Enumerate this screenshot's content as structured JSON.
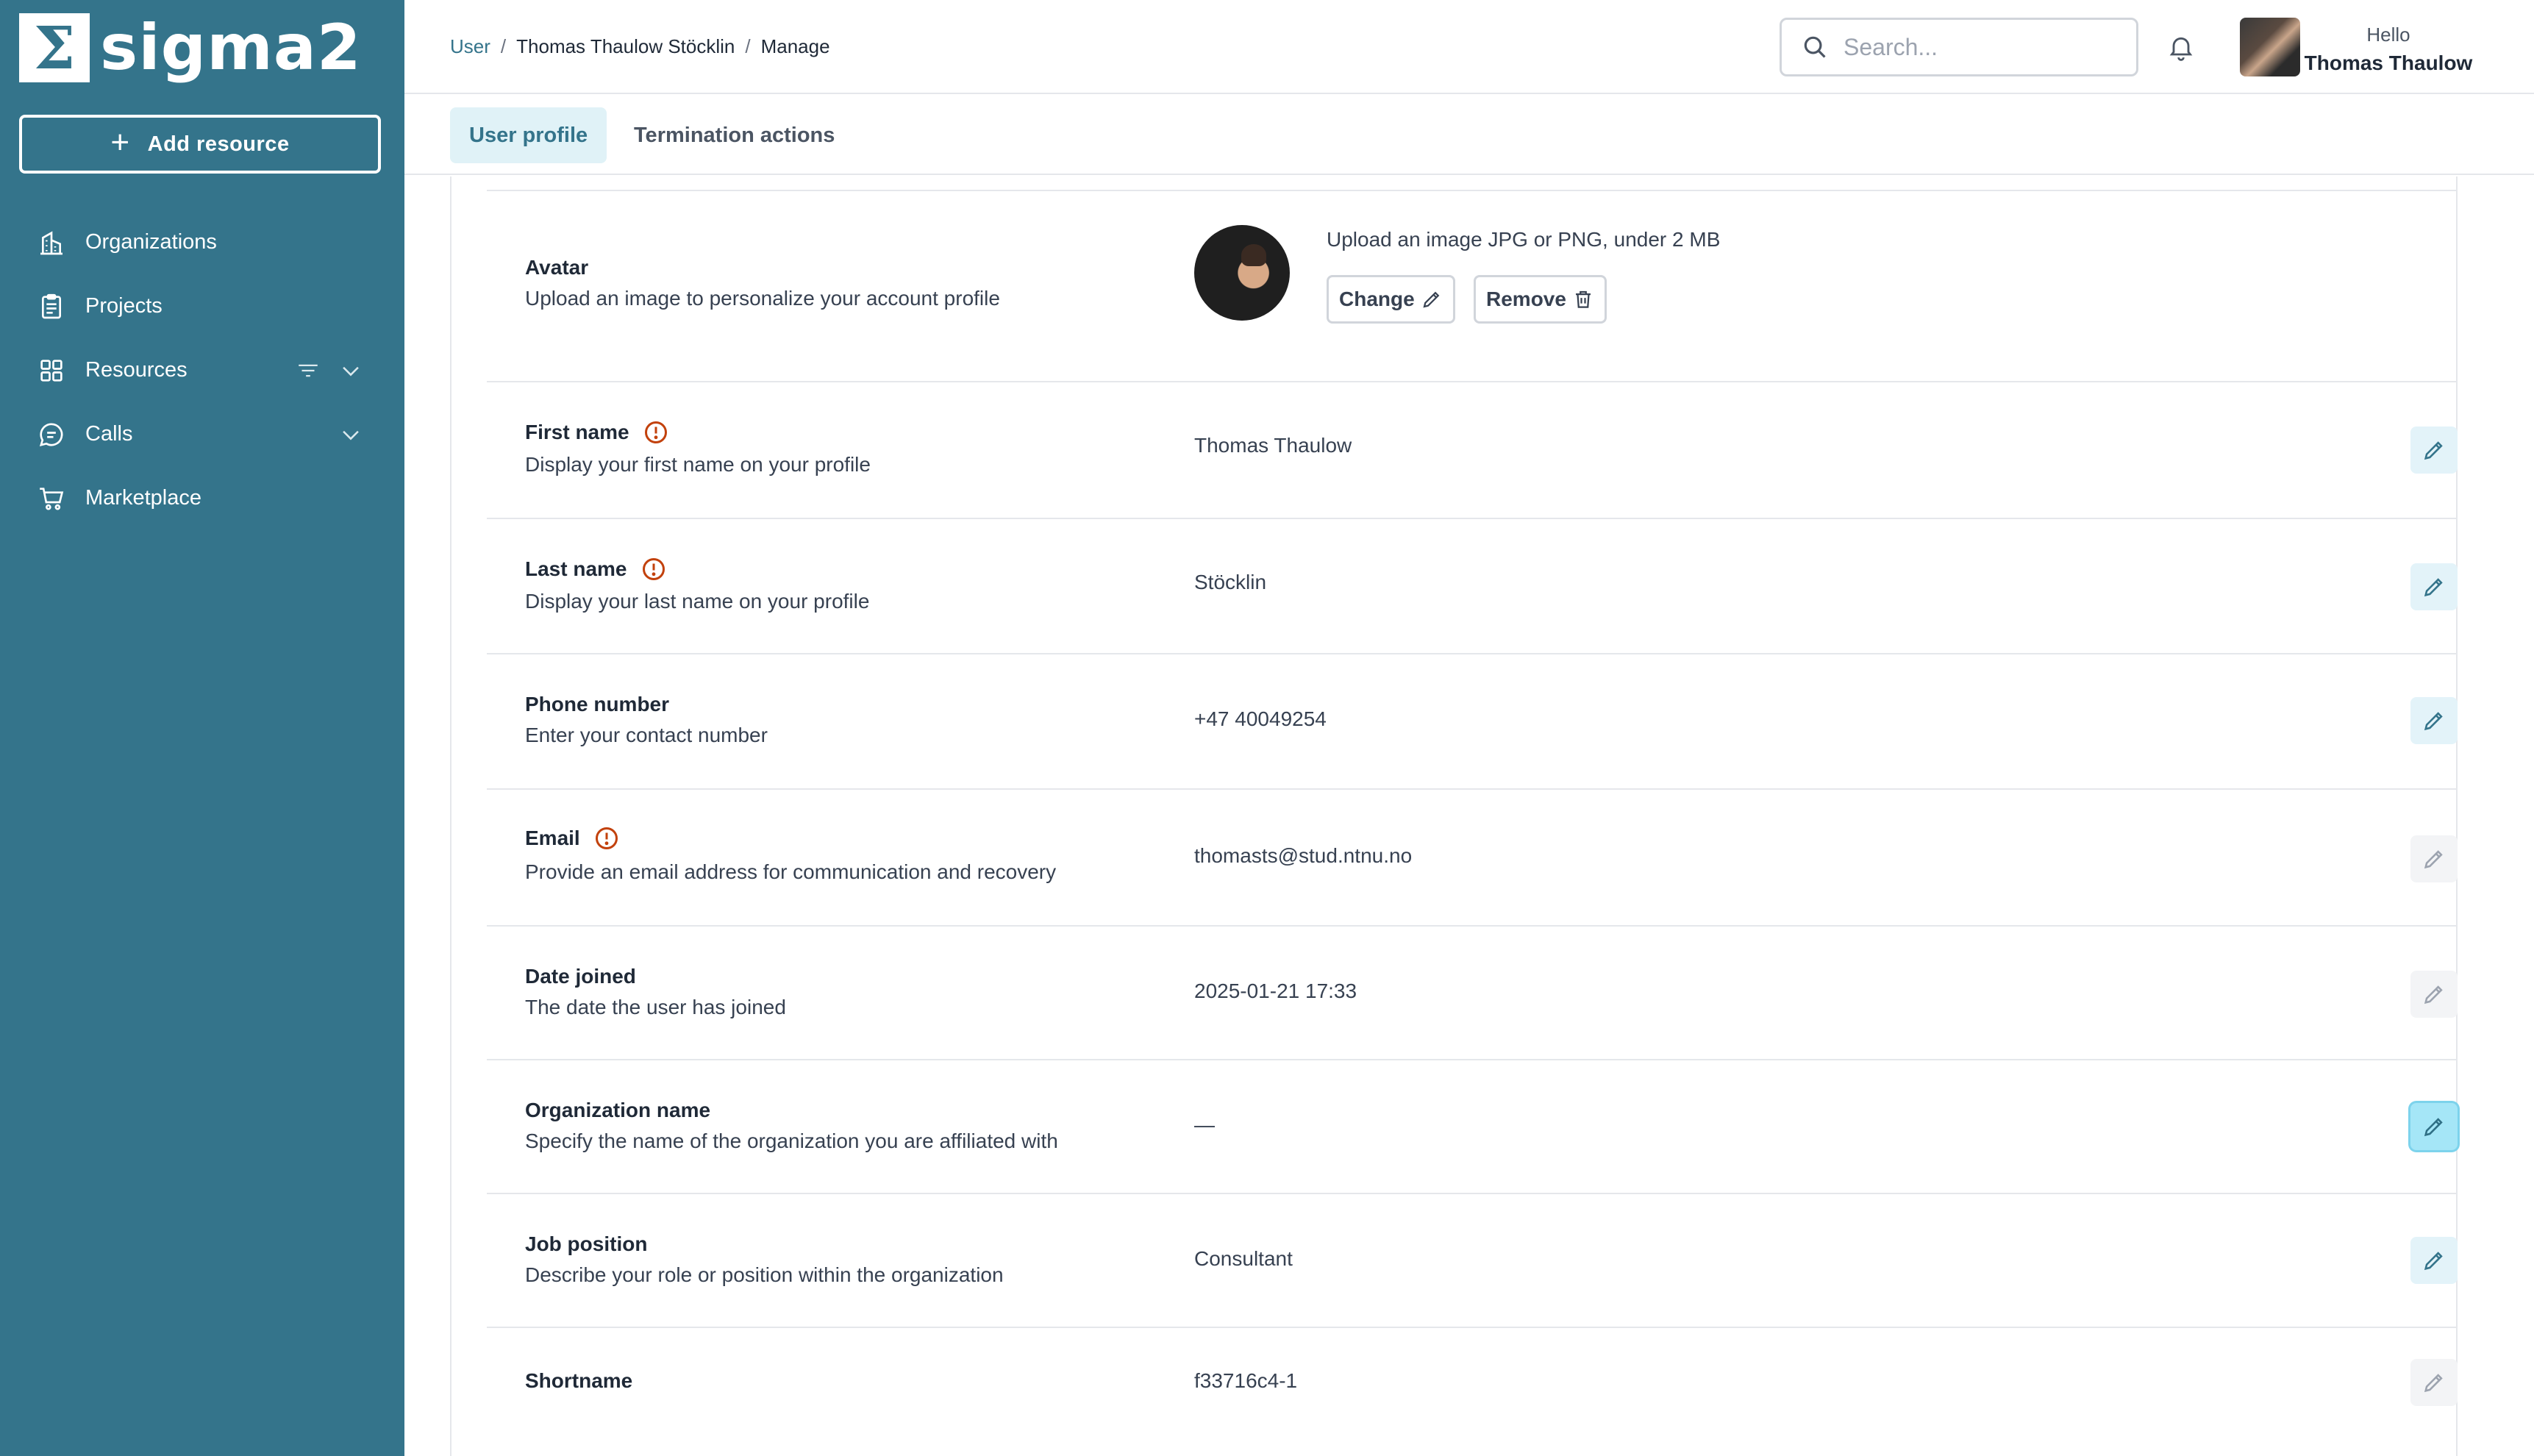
{
  "brand": {
    "logo_mark": "Σ",
    "name": "sigma2"
  },
  "sidebar": {
    "add_resource_label": "Add resource",
    "items": [
      {
        "label": "Organizations",
        "icon": "building-icon"
      },
      {
        "label": "Projects",
        "icon": "clipboard-icon"
      },
      {
        "label": "Resources",
        "icon": "grid-icon"
      },
      {
        "label": "Calls",
        "icon": "chat-icon"
      },
      {
        "label": "Marketplace",
        "icon": "cart-icon"
      }
    ]
  },
  "header": {
    "breadcrumb": [
      "User",
      "Thomas Thaulow Stöcklin",
      "Manage"
    ],
    "search_placeholder": "Search...",
    "greeting": "Hello",
    "user_name": "Thomas Thaulow"
  },
  "tabs": [
    "User profile",
    "Termination actions"
  ],
  "avatar_section": {
    "label": "Avatar",
    "description": "Upload an image to personalize your account profile",
    "hint": "Upload an image JPG or PNG, under 2 MB",
    "change_label": "Change",
    "remove_label": "Remove"
  },
  "fields": [
    {
      "label": "First name",
      "description": "Display your first name on your profile",
      "value": "Thomas Thaulow",
      "warning": true,
      "editable": true
    },
    {
      "label": "Last name",
      "description": "Display your last name on your profile",
      "value": "Stöcklin",
      "warning": true,
      "editable": true
    },
    {
      "label": "Phone number",
      "description": "Enter your contact number",
      "value": "+47 40049254",
      "warning": false,
      "editable": true
    },
    {
      "label": "Email",
      "description": "Provide an email address for communication and recovery",
      "value": "thomasts@stud.ntnu.no",
      "warning": true,
      "editable": false
    },
    {
      "label": "Date joined",
      "description": "The date the user has joined",
      "value": "2025-01-21 17:33",
      "warning": false,
      "editable": false
    },
    {
      "label": "Organization name",
      "description": "Specify the name of the organization you are affiliated with",
      "value": "—",
      "warning": false,
      "editable": true
    },
    {
      "label": "Job position",
      "description": "Describe your role or position within the organization",
      "value": "Consultant",
      "warning": false,
      "editable": true
    },
    {
      "label": "Shortname",
      "description": "",
      "value": "f33716c4-1",
      "warning": false,
      "editable": false
    }
  ],
  "colors": {
    "sidebar": "#34748b",
    "accent": "#34748b",
    "warning": "#c2410c"
  }
}
